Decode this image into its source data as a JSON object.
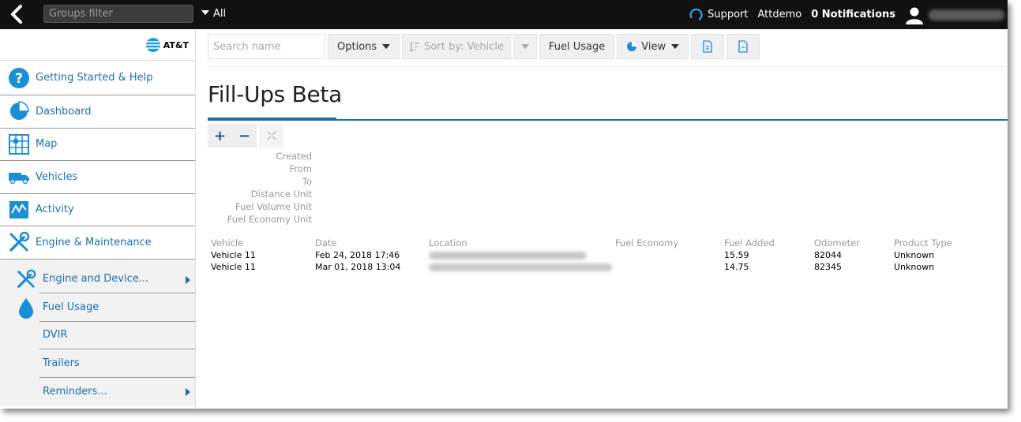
{
  "topbar": {
    "groups_filter_placeholder": "Groups filter",
    "groups_dropdown": "All",
    "support": "Support",
    "account": "Attdemo",
    "notifications": "0 Notifications"
  },
  "brand": {
    "logo_text": "AT&T"
  },
  "sidebar": {
    "items": [
      {
        "label": "Getting Started & Help",
        "icon": "help-icon"
      },
      {
        "label": "Dashboard",
        "icon": "pie-chart-icon"
      },
      {
        "label": "Map",
        "icon": "map-icon"
      },
      {
        "label": "Vehicles",
        "icon": "truck-icon"
      },
      {
        "label": "Activity",
        "icon": "activity-chart-icon"
      },
      {
        "label": "Engine & Maintenance",
        "icon": "wrench-screwdriver-icon"
      }
    ],
    "sub_items": [
      {
        "label": "Engine and Device...",
        "icon": "wrench-screwdriver-icon",
        "has_submenu": true
      },
      {
        "label": "Fuel Usage",
        "icon": "fuel-drop-icon",
        "has_submenu": false
      },
      {
        "label": "DVIR",
        "has_submenu": false
      },
      {
        "label": "Trailers",
        "has_submenu": false
      },
      {
        "label": "Reminders...",
        "has_submenu": true
      }
    ]
  },
  "toolbar": {
    "search_placeholder": "Search name",
    "options_label": "Options",
    "sort_label": "Sort by: Vehicle",
    "fuel_usage_label": "Fuel Usage",
    "view_label": "View"
  },
  "page": {
    "title": "Fill-Ups Beta"
  },
  "report_params": [
    "Created",
    "From",
    "To",
    "Distance Unit",
    "Fuel Volume Unit",
    "Fuel Economy Unit"
  ],
  "table": {
    "columns": [
      "Vehicle",
      "Date",
      "Location",
      "Fuel Economy",
      "Fuel Added",
      "Odometer",
      "Product Type"
    ],
    "rows": [
      {
        "vehicle": "Vehicle 11",
        "date": "Feb 24, 2018 17:46",
        "fuel_economy": "",
        "fuel_added": "15.59",
        "odometer": "82044",
        "product_type": "Unknown"
      },
      {
        "vehicle": "Vehicle 11",
        "date": "Mar 01, 2018 13:04",
        "fuel_economy": "",
        "fuel_added": "14.75",
        "odometer": "82345",
        "product_type": "Unknown"
      }
    ]
  },
  "colors": {
    "accent": "#1a6fb0",
    "topbar": "#111111",
    "sidebar_sub_bg": "#f2f2f2"
  }
}
